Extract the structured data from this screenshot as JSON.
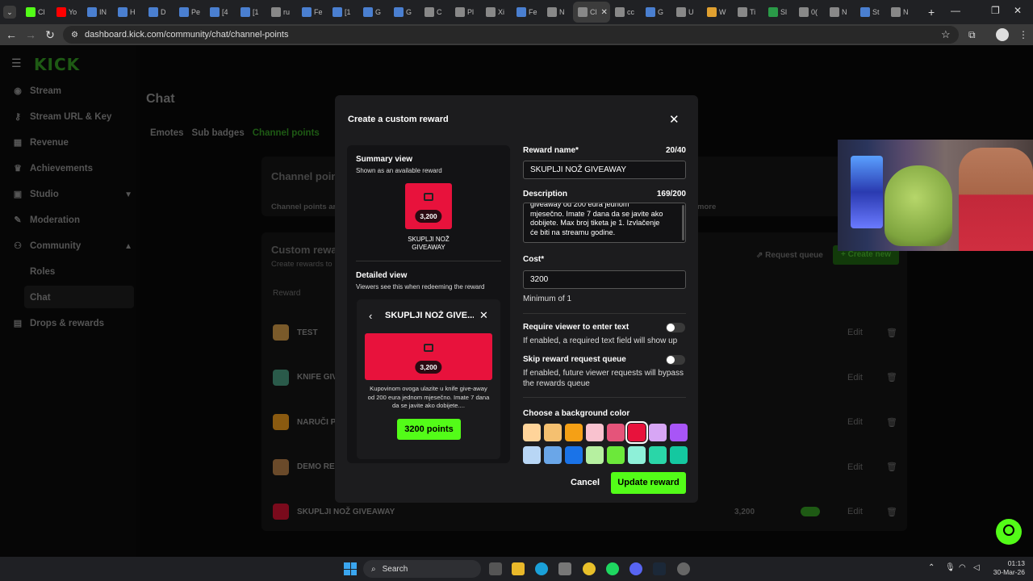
{
  "browser": {
    "tabs": [
      {
        "label": "Cl",
        "color": "#53fc18"
      },
      {
        "label": "Yo",
        "color": "#ff0000"
      },
      {
        "label": "IN",
        "color": "#4a7fd0"
      },
      {
        "label": "H",
        "color": "#4a7fd0"
      },
      {
        "label": "D",
        "color": "#4a7fd0"
      },
      {
        "label": "Pe",
        "color": "#4a7fd0"
      },
      {
        "label": "[4",
        "color": "#4a7fd0"
      },
      {
        "label": "[1",
        "color": "#4a7fd0"
      },
      {
        "label": "ru",
        "color": "#888888"
      },
      {
        "label": "Fe",
        "color": "#4a7fd0"
      },
      {
        "label": "[1",
        "color": "#4a7fd0"
      },
      {
        "label": "G",
        "color": "#4a7fd0"
      },
      {
        "label": "G",
        "color": "#4a7fd0"
      },
      {
        "label": "C",
        "color": "#888888"
      },
      {
        "label": "Pl",
        "color": "#888888"
      },
      {
        "label": "Xi",
        "color": "#888888"
      },
      {
        "label": "Fe",
        "color": "#4a7fd0"
      },
      {
        "label": "N",
        "color": "#888888"
      },
      {
        "label": "Cl",
        "color": "#888888",
        "active": true
      },
      {
        "label": "cc",
        "color": "#888888"
      },
      {
        "label": "G",
        "color": "#4a7fd0"
      },
      {
        "label": "U",
        "color": "#888888"
      },
      {
        "label": "W",
        "color": "#e0a030"
      },
      {
        "label": "Ti",
        "color": "#888888"
      },
      {
        "label": "Sl",
        "color": "#2a9a48"
      },
      {
        "label": "0(",
        "color": "#888888"
      },
      {
        "label": "N",
        "color": "#888888"
      },
      {
        "label": "St",
        "color": "#4a7fd0"
      },
      {
        "label": "N",
        "color": "#888888"
      }
    ],
    "new_tab": "+",
    "url": "dashboard.kick.com/community/chat/channel-points"
  },
  "sidebar": {
    "logo": "KICK",
    "items": [
      {
        "label": "Stream",
        "icon": "stream-icon"
      },
      {
        "label": "Stream URL & Key",
        "icon": "key-icon"
      },
      {
        "label": "Revenue",
        "icon": "revenue-icon"
      },
      {
        "label": "Achievements",
        "icon": "trophy-icon"
      },
      {
        "label": "Studio",
        "icon": "studio-icon"
      },
      {
        "label": "Moderation",
        "icon": "wrench-icon"
      },
      {
        "label": "Community",
        "icon": "community-icon"
      },
      {
        "label": "Drops & rewards",
        "icon": "drops-icon"
      }
    ],
    "sub_items": [
      "Roles",
      "Chat"
    ]
  },
  "main": {
    "title": "Chat",
    "tabs": [
      "Emotes",
      "Sub badges",
      "Channel points"
    ],
    "section1_title": "Channel point",
    "section1_desc": "Channel points ar",
    "more": "more",
    "section2_title": "Custom rewar",
    "section2_desc": "Create rewards to",
    "request_queue": "Request queue",
    "create_new": "+ Create new",
    "col_reward": "Reward",
    "rows": [
      {
        "name": "TEST",
        "color": "#7a5a2a",
        "cost": "",
        "edit": "Edit"
      },
      {
        "name": "KNIFE GIV",
        "color": "#2a5a4a",
        "cost": "",
        "edit": "Edit"
      },
      {
        "name": "NARUČI P",
        "color": "#8a5a10",
        "cost": "",
        "edit": "Edit"
      },
      {
        "name": "DEMO REV",
        "color": "#6a4a2a",
        "cost": "",
        "edit": "Edit"
      },
      {
        "name": "SKUPLJI NOŽ GIVEAWAY",
        "color": "#7a0a1c",
        "cost": "3,200",
        "edit": "Edit"
      }
    ]
  },
  "modal": {
    "title": "Create a custom reward",
    "summary_title": "Summary view",
    "summary_sub": "Shown as an available reward",
    "summary_cost": "3,200",
    "summary_name": "SKUPLJI NOŽ GIVEAWAY",
    "detail_title": "Detailed view",
    "detail_sub": "Viewers see this when redeeming the reward",
    "detail_header": "SKUPLJI NOŽ GIVE...",
    "detail_cost": "3,200",
    "detail_desc": "Kupovinom ovoga ulazite u knife give-away od 200 eura jednom mjesečno. Imate 7 dana da se javite ako dobijete....",
    "detail_button": "3200 points",
    "reward_name_label": "Reward name*",
    "reward_name_count": "20/40",
    "reward_name_value": "SKUPLJI NOŽ GIVEAWAY",
    "description_label": "Description",
    "description_count": "169/200",
    "description_lines": [
      "giveaway od 200 eura jednom",
      "mjesečno. Imate 7 dana da se javite ako",
      "dobijete. Max broj tiketa je 1. Izvlačenje",
      "će biti na streamu godine."
    ],
    "cost_label": "Cost*",
    "cost_value": "3200",
    "cost_helper": "Minimum of 1",
    "require_label": "Require viewer to enter text",
    "require_helper": "If enabled, a required text field will show up",
    "skip_label": "Skip reward request queue",
    "skip_helper": "If enabled, future viewer requests will bypass the rewards queue",
    "color_label": "Choose a background color",
    "colors_row1": [
      "#ffd49a",
      "#f5c070",
      "#f5a015",
      "#f9c2cf",
      "#e5547a",
      "#e8123c",
      "#d7a6f5",
      "#a855f7"
    ],
    "colors_row2": [
      "#b8d6f5",
      "#6aa6e8",
      "#1a73e8",
      "#b6f0a0",
      "#6ce83a",
      "#8ef0d8",
      "#2ad6a8",
      "#14c8a0"
    ],
    "selected_color_index": 5,
    "cancel": "Cancel",
    "update": "Update reward"
  },
  "taskbar": {
    "search": "Search",
    "time": "01:13",
    "date": "30-Mar-26"
  }
}
